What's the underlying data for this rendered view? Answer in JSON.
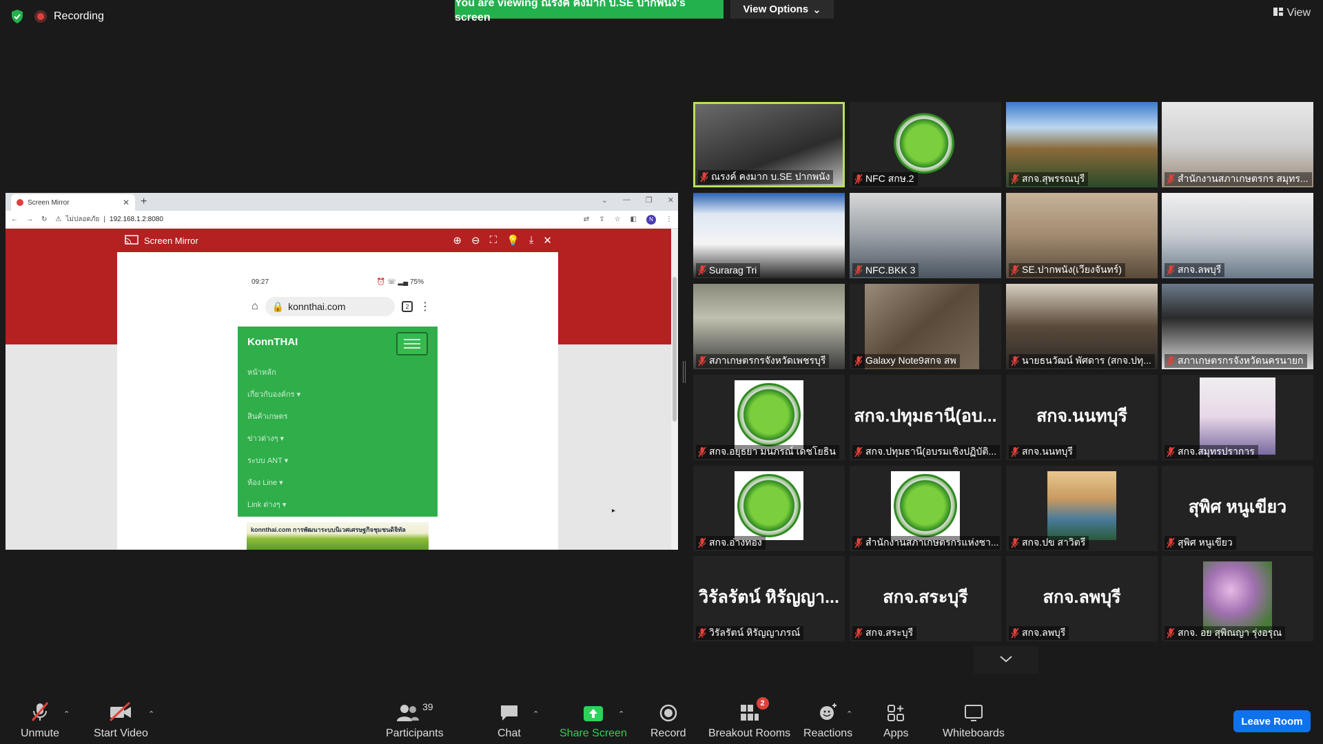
{
  "top": {
    "recording": "Recording",
    "viewing_banner": "You are viewing ณรงค์ คงมาก บ.SE ปากพนัง's screen",
    "view_options": "View Options",
    "view": "View"
  },
  "shared_screen": {
    "tab_title": "Screen Mirror",
    "addr_warning": "ไม่ปลอดภัย",
    "addr_url": "192.168.1.2:8080",
    "profile_initial": "N",
    "app_title": "Screen Mirror",
    "phone_time": "09:27",
    "phone_status": "⏰ ☏ ▂▄ 75%",
    "phone_url": "konnthai.com",
    "phone_tab_count": "2",
    "site_brand": "KonnTHAI",
    "menu_items": [
      "หน้าหลัก",
      "เกี่ยวกับองค์กร ▾",
      "สินค้าเกษตร",
      "ข่าวต่างๆ ▾",
      "ระบบ ANT ▾",
      "ห้อง Line ▾",
      "Link ต่างๆ ▾"
    ],
    "banner_text": "konnthai.com การพัฒนาระบบนิเวศเศรษฐกิจชุมชนดิจิทัล"
  },
  "participants": [
    {
      "name": "ณรงค์ คงมาก บ.SE ปากพนัง"
    },
    {
      "name": "NFC สกษ.2"
    },
    {
      "name": "สกจ.สุพรรณบุรี"
    },
    {
      "name": "สำนักงานสภาเกษตรกร สมุทร..."
    },
    {
      "name": "Surarag Tri"
    },
    {
      "name": "NFC.BKK 3"
    },
    {
      "name": "SE.ปากพนัง(เวียงจันทร์)"
    },
    {
      "name": "สกจ.ลพบุรี"
    },
    {
      "name": "สภาเกษตรกรจังหวัดเพชรบุรี"
    },
    {
      "name": "Galaxy Note9สกจ สพ"
    },
    {
      "name": "นายธนวัฒน์ พัศดาร (สกจ.ปทุ..."
    },
    {
      "name": "สภาเกษตรกรจังหวัดนครนายก"
    },
    {
      "name": "สกจ.อยุธยา มนภรณ์ เดชโยธิน"
    },
    {
      "name": "สกจ.ปทุมธานี(อบรมเชิงปฏิบัติ...",
      "big": "สกจ.ปทุมธานี(อบ..."
    },
    {
      "name": "สกจ.นนทบุรี",
      "big": "สกจ.นนทบุรี"
    },
    {
      "name": "สกจ.สมุทรปราการ"
    },
    {
      "name": "สกจ.อ่างทอง"
    },
    {
      "name": "สำนักงานสภาเกษตรกรแห่งชา..."
    },
    {
      "name": "สกจ.ปข สาวิตรี"
    },
    {
      "name": "สุพิศ หนูเขียว",
      "big": "สุพิศ หนูเขียว"
    },
    {
      "name": "วิรัลรัตน์ หิรัญญาภรณ์",
      "big": "วิรัลรัตน์ หิรัญญา..."
    },
    {
      "name": "สกจ.สระบุรี",
      "big": "สกจ.สระบุรี"
    },
    {
      "name": "สกจ.ลพบุรี",
      "big": "สกจ.ลพบุรี"
    },
    {
      "name": "สกจ. อย สุพิณญา รุ่งอรุณ"
    }
  ],
  "toolbar": {
    "unmute": "Unmute",
    "start_video": "Start Video",
    "participants": "Participants",
    "participant_count": "39",
    "chat": "Chat",
    "share_screen": "Share Screen",
    "record": "Record",
    "breakout_rooms": "Breakout Rooms",
    "breakout_badge": "2",
    "reactions": "Reactions",
    "apps": "Apps",
    "whiteboards": "Whiteboards",
    "leave_room": "Leave Room"
  },
  "colors": {
    "accent_green": "#22b14c",
    "leave_blue": "#0e72ed",
    "speaking_border": "#b9e05a",
    "mute_red": "#e0413a"
  }
}
